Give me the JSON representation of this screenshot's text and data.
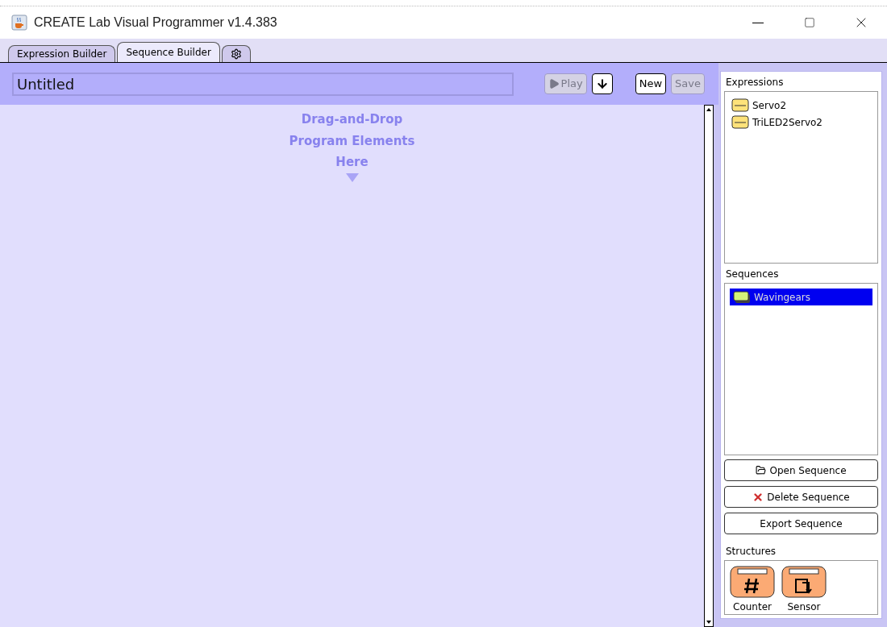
{
  "window": {
    "title": "CREATE Lab Visual Programmer v1.4.383"
  },
  "tabs": [
    {
      "kind": "text",
      "label": "Expression Builder",
      "selected": false
    },
    {
      "kind": "text",
      "label": "Sequence Builder",
      "selected": true
    },
    {
      "kind": "gear",
      "selected": false
    }
  ],
  "sequence_name": {
    "value": "Untitled"
  },
  "toolbar": [
    {
      "kind": "play",
      "label": "Play",
      "disabled": true
    },
    {
      "kind": "download",
      "disabled": false
    },
    {
      "kind": "text",
      "label": "New",
      "disabled": false
    },
    {
      "kind": "text",
      "label": "Save",
      "disabled": true
    }
  ],
  "canvas": {
    "hint": [
      "Drag-and-Drop",
      "Program Elements",
      "Here"
    ]
  },
  "expressions": {
    "title": "Expressions",
    "items": [
      {
        "label": "Servo2",
        "selected": false
      },
      {
        "label": "TriLED2Servo2",
        "selected": false
      }
    ]
  },
  "sequences": {
    "title": "Sequences",
    "items": [
      {
        "label": "Wavingears",
        "selected": true
      }
    ]
  },
  "sequence_buttons": [
    {
      "kind": "open",
      "label": "Open Sequence"
    },
    {
      "kind": "delete",
      "label": "Delete Sequence"
    },
    {
      "kind": "text",
      "label": "Export Sequence"
    }
  ],
  "structures": {
    "title": "Structures",
    "items": [
      {
        "kind": "counter",
        "label": "Counter"
      },
      {
        "kind": "sensor",
        "label": "Sensor"
      }
    ]
  }
}
